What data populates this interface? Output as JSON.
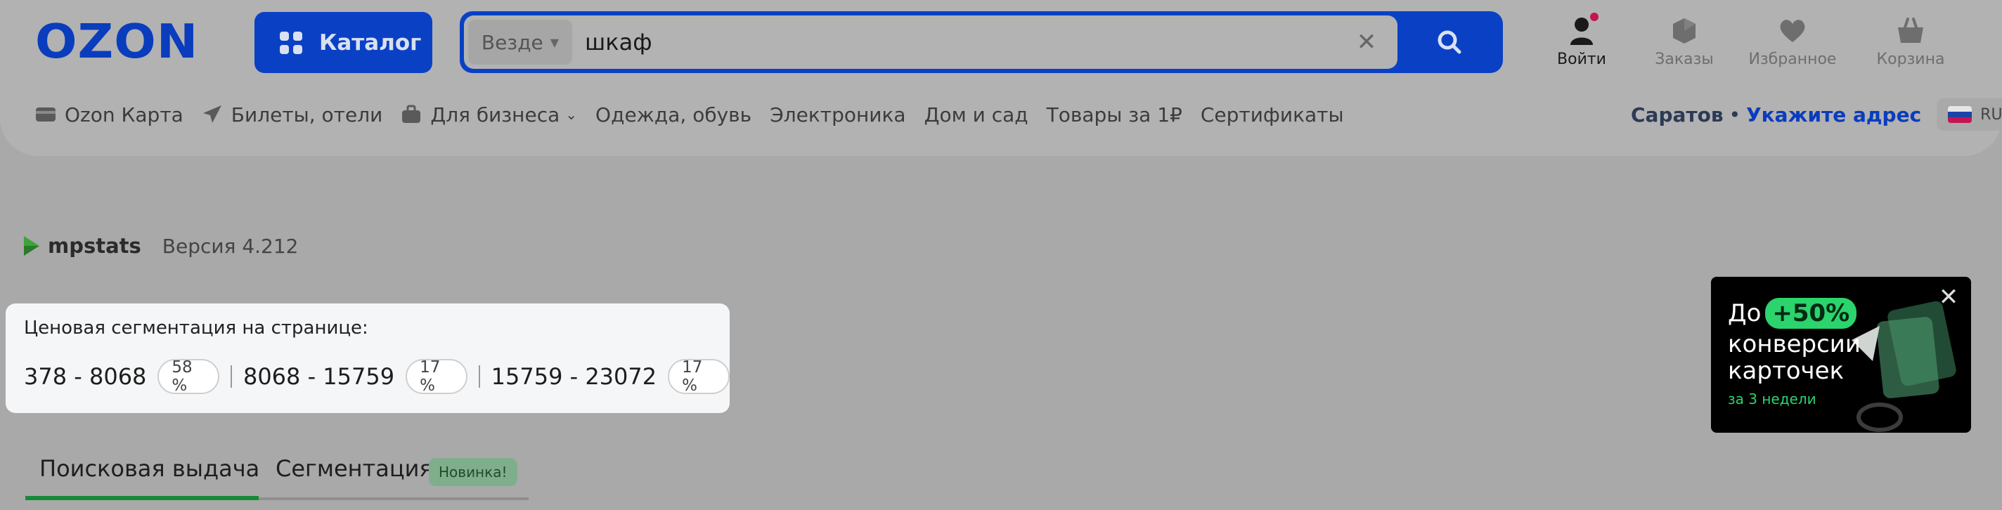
{
  "header": {
    "logo": "OZON",
    "catalog_label": "Каталог",
    "search": {
      "scope": "Везде",
      "value": "шкаф"
    },
    "user_actions": {
      "login": "Войти",
      "orders": "Заказы",
      "favorites": "Избранное",
      "cart": "Корзина"
    },
    "nav": [
      {
        "label": "Ozon Карта",
        "icon": "card-icon"
      },
      {
        "label": "Билеты, отели",
        "icon": "plane-icon"
      },
      {
        "label": "Для бизнеса",
        "icon": "briefcase-icon",
        "dropdown": true
      },
      {
        "label": "Одежда, обувь"
      },
      {
        "label": "Электроника"
      },
      {
        "label": "Дом и сад"
      },
      {
        "label": "Товары за 1₽"
      },
      {
        "label": "Сертификаты"
      }
    ],
    "location": {
      "city": "Саратов",
      "separator": "•",
      "address_link": "Укажите адрес",
      "language": "RU"
    }
  },
  "mpstats": {
    "brand": "mpstats",
    "version": "Версия 4.212"
  },
  "segmentation": {
    "title": "Ценовая сегментация на странице:",
    "segments": [
      {
        "range": "378 - 8068",
        "percent": "58 %"
      },
      {
        "range": "8068 - 15759",
        "percent": "17 %"
      },
      {
        "range": "15759 - 23072",
        "percent": "17 %"
      }
    ]
  },
  "tabs": {
    "search_results": "Поисковая выдача",
    "segmentation": "Сегментация",
    "new_badge": "Новинка!"
  },
  "promo": {
    "line1_prefix": "До",
    "line1_pill": "+50%",
    "line2": "конверсии",
    "line3": "карточек",
    "line4": "за 3 недели"
  },
  "colors": {
    "brand_blue": "#0a41c4",
    "accent_green": "#168a37",
    "promo_green": "#2bd46c",
    "notification": "#c4154f"
  }
}
